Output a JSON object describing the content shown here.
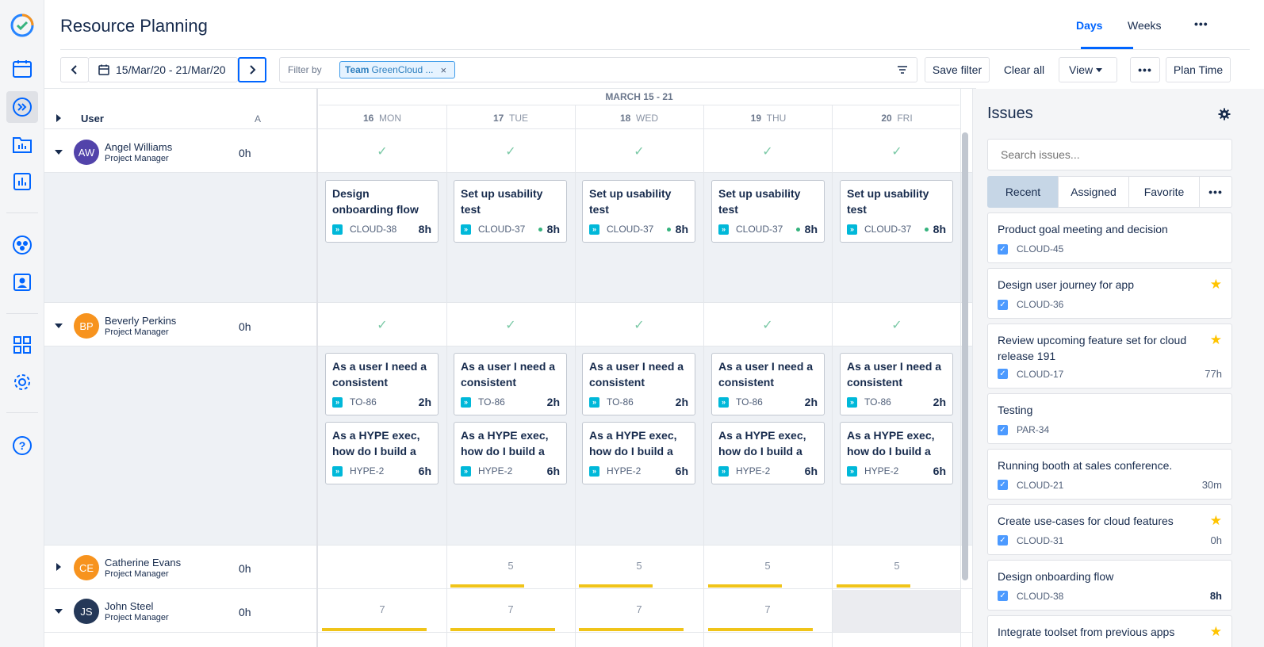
{
  "header": {
    "title": "Resource Planning",
    "view_tabs": [
      "Days",
      "Weeks"
    ],
    "selected_view": "Days",
    "more": "•••"
  },
  "toolbar": {
    "date_range": "15/Mar/20 - 21/Mar/20",
    "filter_label": "Filter by",
    "filter_chip_bold": "Team",
    "filter_chip_text": "GreenCloud ...",
    "chip_close": "×",
    "save_filter": "Save filter",
    "clear_all": "Clear all",
    "view": "View",
    "more": "•••",
    "plan_time": "Plan Time"
  },
  "grid": {
    "col_user": "User",
    "col_a": "A",
    "week_label": "MARCH 15 - 21",
    "days": [
      {
        "num": "16",
        "name": "MON"
      },
      {
        "num": "17",
        "name": "TUE"
      },
      {
        "num": "18",
        "name": "WED"
      },
      {
        "num": "19",
        "name": "THU"
      },
      {
        "num": "20",
        "name": "FRI"
      }
    ],
    "check": "✓"
  },
  "users": [
    {
      "initials": "AW",
      "name": "Angel Williams",
      "role": "Project Manager",
      "hours": "0h",
      "color": "#5243aa"
    },
    {
      "initials": "BP",
      "name": "Beverly Perkins",
      "role": "Project Manager",
      "hours": "0h",
      "color": "#f7931e"
    },
    {
      "initials": "CE",
      "name": "Catherine Evans",
      "role": "Project Manager",
      "hours": "0h",
      "color": "#f7931e"
    },
    {
      "initials": "JS",
      "name": "John Steel",
      "role": "Project Manager",
      "hours": "0h",
      "color": "#253858"
    }
  ],
  "cards": {
    "aw": [
      {
        "title": "Design onboarding flow",
        "key": "CLOUD-38",
        "hours": "8h",
        "dot": false
      },
      {
        "title": "Set up usability test",
        "key": "CLOUD-37",
        "hours": "8h",
        "dot": true
      },
      {
        "title": "Set up usability test",
        "key": "CLOUD-37",
        "hours": "8h",
        "dot": true
      },
      {
        "title": "Set up usability test",
        "key": "CLOUD-37",
        "hours": "8h",
        "dot": true
      },
      {
        "title": "Set up usability test",
        "key": "CLOUD-37",
        "hours": "8h",
        "dot": true
      }
    ],
    "bp1": {
      "title": "As a user I need a consistent",
      "key": "TO-86",
      "hours": "2h"
    },
    "bp2": {
      "title": "As a HYPE exec, how do I build a",
      "key": "HYPE-2",
      "hours": "6h"
    }
  },
  "ce_values": [
    "",
    "5",
    "5",
    "5",
    "5"
  ],
  "ce_fill": [
    0,
    0.6,
    0.6,
    0.6,
    0.6
  ],
  "js_values": [
    "7",
    "7",
    "7",
    "7",
    ""
  ],
  "js_fill": [
    0.85,
    0.85,
    0.85,
    0.85,
    0
  ],
  "issues_panel": {
    "title": "Issues",
    "search_placeholder": "Search issues...",
    "tabs": [
      "Recent",
      "Assigned",
      "Favorite"
    ],
    "selected_tab": "Recent",
    "more": "•••",
    "items": [
      {
        "title": "Product goal meeting and decision",
        "key": "CLOUD-45",
        "estimate": "",
        "star": false
      },
      {
        "title": "Design user journey for app",
        "key": "CLOUD-36",
        "estimate": "",
        "star": true
      },
      {
        "title": "Review upcoming feature set for cloud release 191",
        "key": "CLOUD-17",
        "estimate": "77h",
        "star": true
      },
      {
        "title": "Testing",
        "key": "PAR-34",
        "estimate": "",
        "star": false
      },
      {
        "title": "Running booth at sales conference.",
        "key": "CLOUD-21",
        "estimate": "30m",
        "star": false
      },
      {
        "title": "Create use-cases for cloud features",
        "key": "CLOUD-31",
        "estimate": "0h",
        "star": true
      },
      {
        "title": "Design onboarding flow",
        "key": "CLOUD-38",
        "estimate": "8h",
        "star": false
      },
      {
        "title": "Integrate toolset from previous apps",
        "key": "",
        "estimate": "",
        "star": true
      }
    ]
  },
  "colors": {
    "accent": "#0065ff",
    "bar": "#f0c419",
    "check": "#7bc9a6"
  }
}
